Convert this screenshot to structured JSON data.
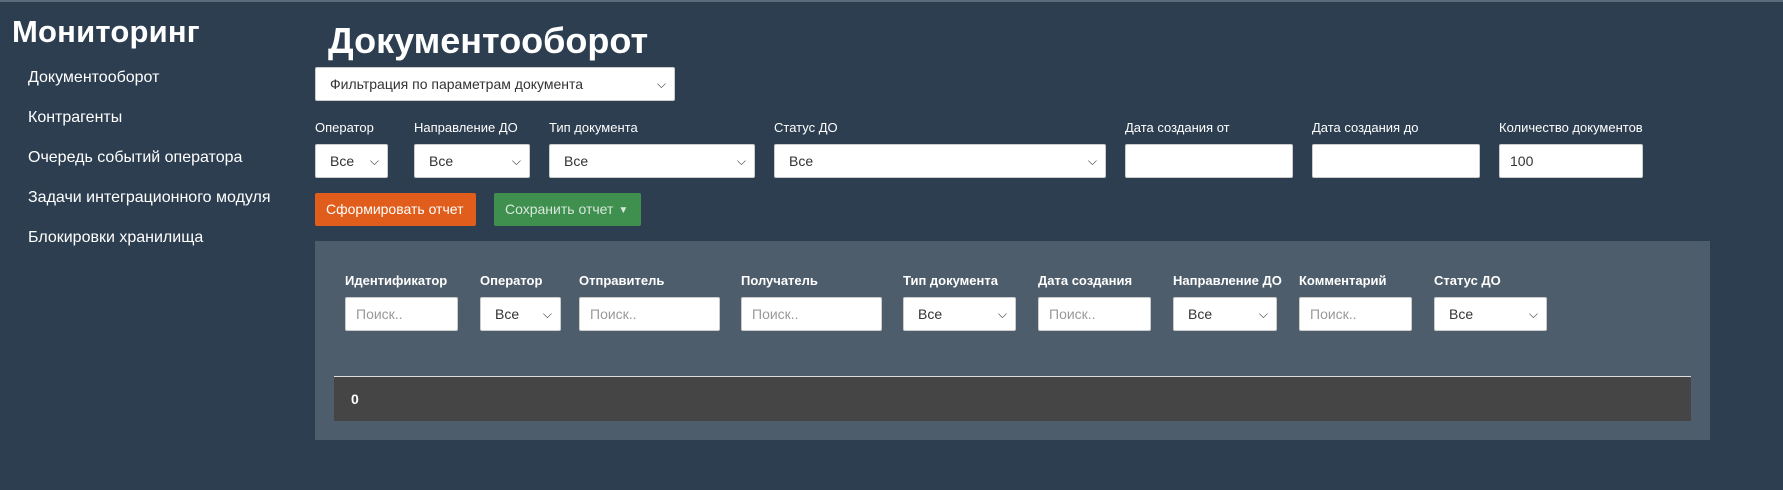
{
  "sidebar": {
    "brand": "Мониторинг",
    "items": [
      {
        "label": "Документооборот"
      },
      {
        "label": "Контрагенты"
      },
      {
        "label": "Очередь событий оператора"
      },
      {
        "label": "Задачи интеграционного модуля"
      },
      {
        "label": "Блокировки хранилища"
      }
    ]
  },
  "main": {
    "title": "Документооборот",
    "filter_mode": "Фильтрация по параметрам документа",
    "filters": {
      "operator": {
        "label": "Оператор",
        "value": "Все"
      },
      "direction": {
        "label": "Направление ДО",
        "value": "Все"
      },
      "doc_type": {
        "label": "Тип документа",
        "value": "Все"
      },
      "status": {
        "label": "Статус ДО",
        "value": "Все"
      },
      "date_from": {
        "label": "Дата создания от",
        "value": ""
      },
      "date_to": {
        "label": "Дата создания до",
        "value": ""
      },
      "count": {
        "label": "Количество документов",
        "value": "100"
      }
    },
    "buttons": {
      "generate": "Сформировать отчет",
      "save": "Сохранить отчет"
    },
    "table": {
      "columns": [
        {
          "label": "Идентификатор",
          "kind": "input",
          "value": "Поиск.."
        },
        {
          "label": "Оператор",
          "kind": "select",
          "value": "Все"
        },
        {
          "label": "Отправитель",
          "kind": "input",
          "value": "Поиск.."
        },
        {
          "label": "Получатель",
          "kind": "input",
          "value": "Поиск.."
        },
        {
          "label": "Тип документа",
          "kind": "select",
          "value": "Все"
        },
        {
          "label": "Дата создания",
          "kind": "input",
          "value": "Поиск.."
        },
        {
          "label": "Направление ДО",
          "kind": "select",
          "value": "Все"
        },
        {
          "label": "Комментарий",
          "kind": "input",
          "value": "Поиск.."
        },
        {
          "label": "Статус ДО",
          "kind": "select",
          "value": "Все"
        }
      ],
      "result_count": "0"
    }
  },
  "colors": {
    "background": "#2c3e50",
    "panel": "#4e5d6c",
    "primary_button": "#e05d1b",
    "save_button": "#3f8f4f",
    "result_bar": "#454545"
  }
}
